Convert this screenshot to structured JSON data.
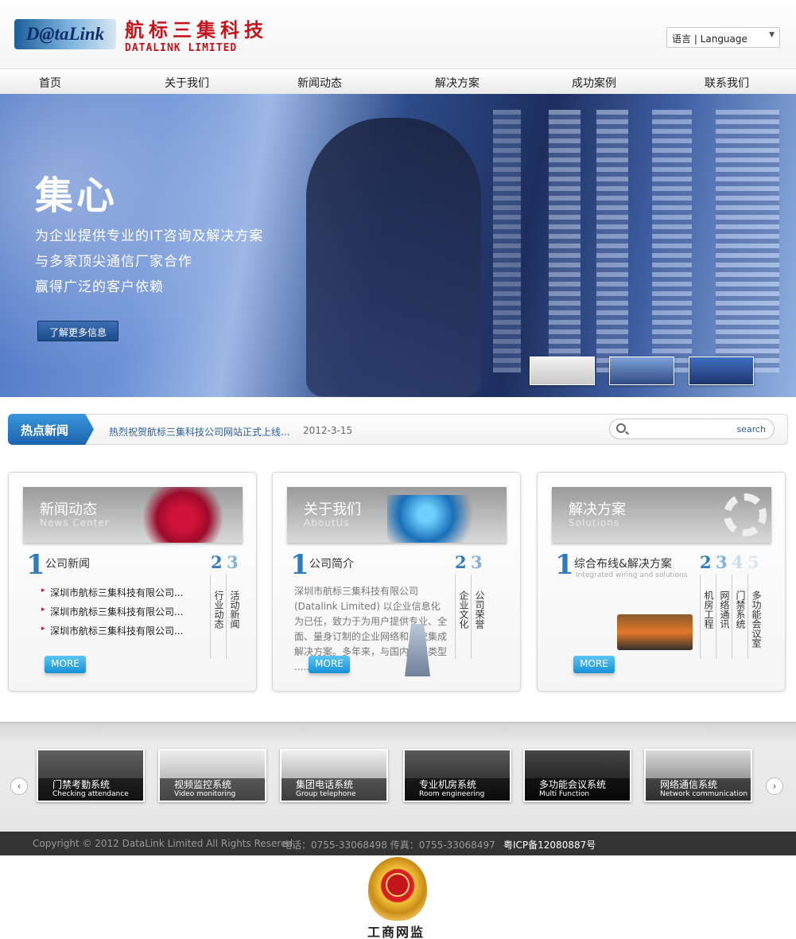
{
  "header": {
    "logo_text": "D@taLink",
    "brand_cn": "航标三集科技",
    "brand_en": "DATALINK LIMITED",
    "language_select": "语言 | Language"
  },
  "nav": [
    "首页",
    "关于我们",
    "新闻动态",
    "解决方案",
    "成功案例",
    "联系我们"
  ],
  "hero": {
    "title": "集心",
    "lines": [
      "为企业提供专业的IT咨询及解决方案",
      "与多家顶尖通信厂家合作",
      "赢得广泛的客户依赖"
    ],
    "button": "了解更多信息"
  },
  "hot_news": {
    "label": "热点新闻",
    "headline": "热烈祝贺航标三集科技公司网站正式上线...",
    "date": "2012-3-15",
    "search_label": "search"
  },
  "cards": {
    "news": {
      "title": "新闻动态",
      "subtitle": "News Center",
      "heading": "公司新闻",
      "items": [
        "深圳市航标三集科技有限公司...",
        "深圳市航标三集科技有限公司...",
        "深圳市航标三集科技有限公司..."
      ],
      "tab2": "行业动态",
      "tab3": "活动新闻",
      "more": "MORE"
    },
    "about": {
      "title": "关于我们",
      "subtitle": "AboutUs",
      "heading": "公司简介",
      "text": "深圳市航标三集科技有限公司(Datalink Limited) 以企业信息化为已任，致力于为用户提供专业、全面、量身订制的企业网络和系统集成解决方案。多年来，与国内不同类型 .....",
      "tab2": "企业文化",
      "tab3": "公司荣誉",
      "more": "MORE"
    },
    "solutions": {
      "title": "解决方案",
      "subtitle": "Solutions",
      "heading": "综合布线&解决方案",
      "heading_en": "Integrated wiring and solutions",
      "tab2": "机房工程",
      "tab3": "网络通讯",
      "tab4": "门禁系统",
      "tab5": "多功能会议室",
      "more": "MORE"
    }
  },
  "products": [
    {
      "cn": "门禁考勤系统",
      "en": "Checking attendance"
    },
    {
      "cn": "视频监控系统",
      "en": "Video monitoring"
    },
    {
      "cn": "集团电话系统",
      "en": "Group telephone"
    },
    {
      "cn": "专业机房系统",
      "en": "Room engineering"
    },
    {
      "cn": "多功能会议系统",
      "en": "Multi Function"
    },
    {
      "cn": "网络通信系统",
      "en": "Network communication"
    }
  ],
  "footer": {
    "copyright": "Copyright © 2012 DataLink Limited All Rights Resered.",
    "phone": "电话：0755-33068498 传真：0755-33068497",
    "icp": "粤ICP备12080887号"
  },
  "badge_label": "工商网监",
  "colors": {
    "brand_red": "#c3151b",
    "accent_blue": "#2e7bbf",
    "footer_bg": "#333333"
  }
}
